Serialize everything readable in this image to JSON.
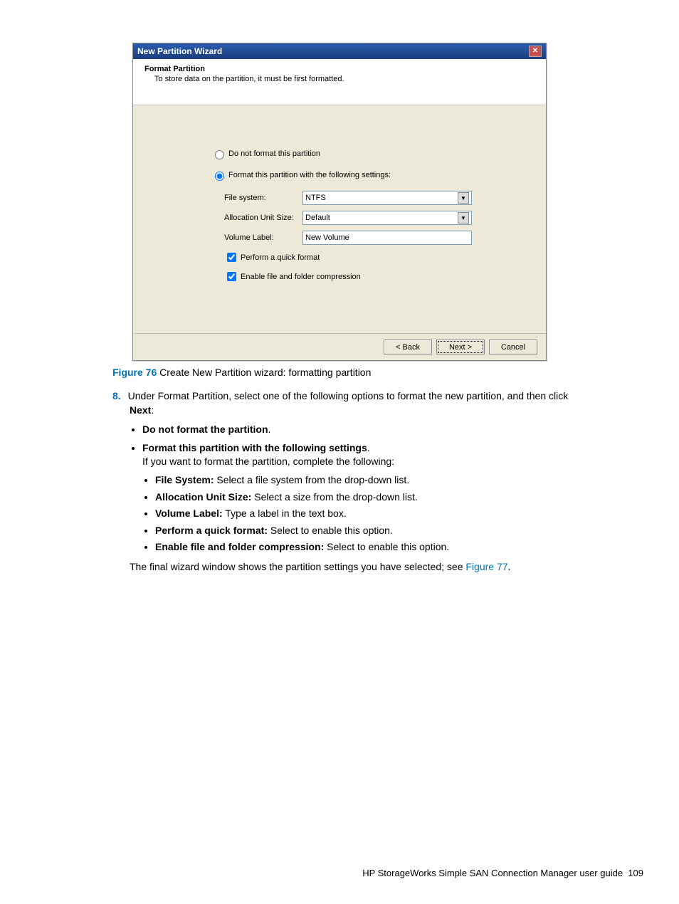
{
  "dialog": {
    "title": "New Partition Wizard",
    "header_heading": "Format Partition",
    "header_sub": "To store data on the partition, it must be first formatted.",
    "radio_no_format": "Do not format this partition",
    "radio_format": "Format this partition with the following settings:",
    "file_system_label": "File system:",
    "file_system_value": "NTFS",
    "alloc_label": "Allocation Unit Size:",
    "alloc_value": "Default",
    "volume_label": "Volume Label:",
    "volume_value": "New Volume",
    "chk_quick": "Perform a quick format",
    "chk_compress": "Enable file and folder compression",
    "btn_back": "< Back",
    "btn_next": "Next >",
    "btn_cancel": "Cancel"
  },
  "caption": {
    "label": "Figure 76",
    "text": "Create New Partition wizard: formatting partition"
  },
  "step": {
    "num": "8.",
    "intro_a": "Under Format Partition, select one of the following options to format the new partition, and then click",
    "intro_b": "Next",
    "intro_c": ":",
    "b1": "Do not format the partition",
    "b1_tail": ".",
    "b2": "Format this partition with the following settings",
    "b2_tail": ".",
    "b2_sub": "If you want to format the partition, complete the following:",
    "s1a": "File System:",
    "s1b": " Select a file system from the drop-down list.",
    "s2a": "Allocation Unit Size:",
    "s2b": " Select a size from the drop-down list.",
    "s3a": "Volume Label:",
    "s3b": " Type a label in the text box.",
    "s4a": "Perform a quick format:",
    "s4b": " Select to enable this option.",
    "s5a": "Enable file and folder compression:",
    "s5b": " Select to enable this option.",
    "final_a": "The final wizard window shows the partition settings you have selected; see ",
    "final_link": "Figure 77",
    "final_tail": "."
  },
  "footer": {
    "text": "HP StorageWorks Simple SAN Connection Manager user guide",
    "page": "109"
  }
}
